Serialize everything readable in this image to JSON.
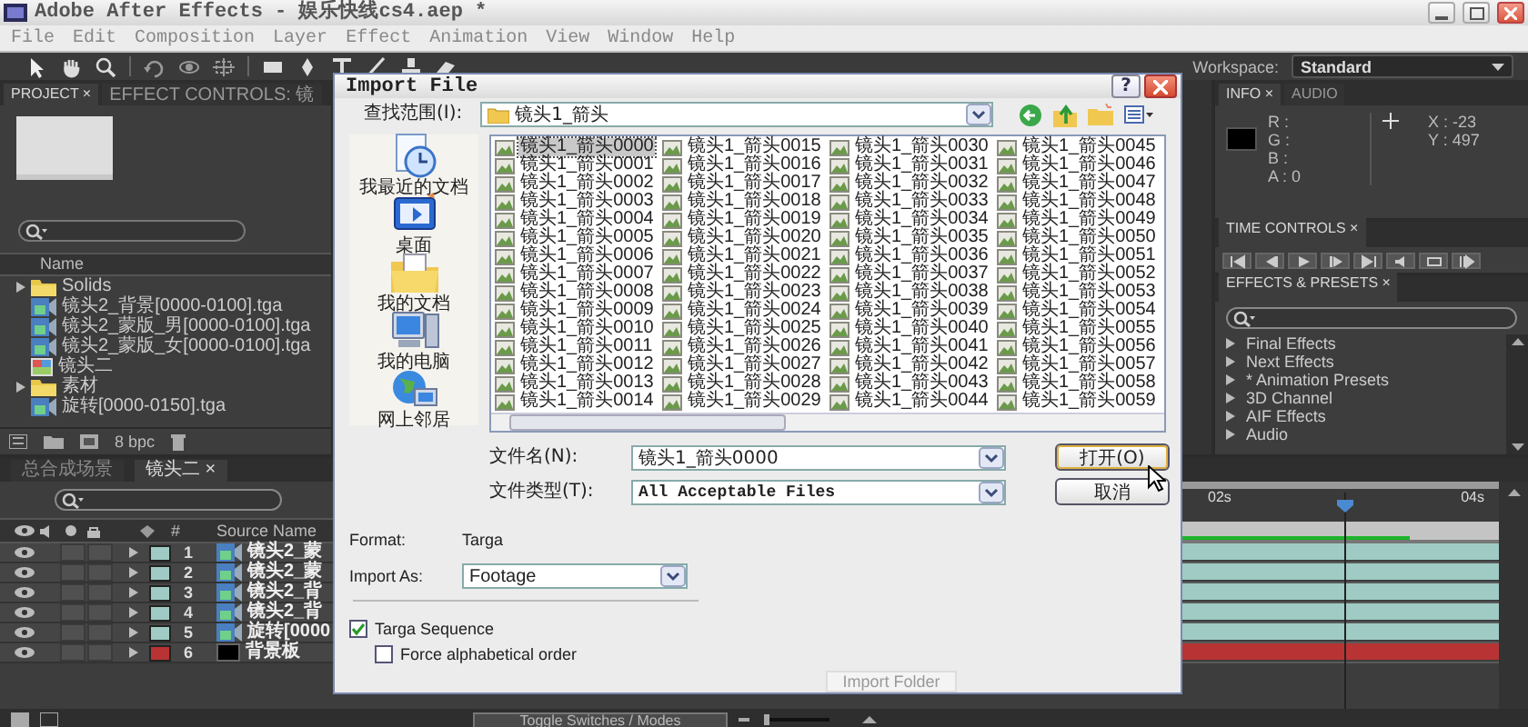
{
  "window": {
    "title": "Adobe After Effects - 娱乐快线cs4.aep *"
  },
  "menu": [
    "File",
    "Edit",
    "Composition",
    "Layer",
    "Effect",
    "Animation",
    "View",
    "Window",
    "Help"
  ],
  "workspace": {
    "label": "Workspace:",
    "value": "Standard"
  },
  "project_panel": {
    "tabs": [
      {
        "label": "PROJECT ×",
        "selected": true
      },
      {
        "label": "EFFECT CONTROLS: 镜",
        "selected": false
      }
    ],
    "column": "Name",
    "items": [
      {
        "kind": "folder",
        "name": "Solids"
      },
      {
        "kind": "sequence",
        "name": "镜头2_背景[0000-0100].tga"
      },
      {
        "kind": "sequence",
        "name": "镜头2_蒙版_男[0000-0100].tga"
      },
      {
        "kind": "sequence",
        "name": "镜头2_蒙版_女[0000-0100].tga"
      },
      {
        "kind": "comp",
        "name": "镜头二"
      },
      {
        "kind": "folder",
        "name": "素材"
      },
      {
        "kind": "sequence",
        "name": "旋转[0000-0150].tga"
      }
    ],
    "bit_depth": "8 bpc"
  },
  "info_panel": {
    "tabs": [
      {
        "label": "INFO ×",
        "selected": true
      },
      {
        "label": "AUDIO",
        "selected": false
      }
    ],
    "channels": [
      "R :",
      "G :",
      "B :",
      "A : 0"
    ],
    "coordinates": [
      "X : -23",
      "Y : 497"
    ]
  },
  "time_controls": {
    "tab": "TIME CONTROLS ×"
  },
  "effects_panel": {
    "tab": "EFFECTS & PRESETS ×",
    "items": [
      "Final Effects",
      "Next Effects",
      "* Animation Presets",
      "3D Channel",
      "AIF Effects",
      "Audio"
    ]
  },
  "timeline": {
    "tabs": [
      {
        "label": "总合成场景",
        "selected": false
      },
      {
        "label": "镜头二 ×",
        "selected": true
      }
    ],
    "columns": {
      "number": "#",
      "source": "Source Name"
    },
    "layers": [
      {
        "number": "1",
        "kind": "footage",
        "name": "镜头2_蒙",
        "color": "#9fcbc4"
      },
      {
        "number": "2",
        "kind": "footage",
        "name": "镜头2_蒙",
        "color": "#9fcbc4"
      },
      {
        "number": "3",
        "kind": "footage",
        "name": "镜头2_背",
        "color": "#9fcbc4"
      },
      {
        "number": "4",
        "kind": "footage",
        "name": "镜头2_背",
        "color": "#9fcbc4"
      },
      {
        "number": "5",
        "kind": "footage",
        "name": "旋转[0000",
        "color": "#9fcbc4"
      },
      {
        "number": "6",
        "kind": "solid",
        "name": "背景板",
        "color": "#b83434"
      }
    ],
    "ruler": [
      "02s",
      "04s"
    ],
    "toggle_button": "Toggle Switches / Modes"
  },
  "dialog": {
    "title": "Import File",
    "help_button": "?",
    "look_in": {
      "label": "查找范围(I):",
      "value": "镜头1_箭头"
    },
    "places": [
      {
        "kind": "recent",
        "label": "我最近的文档"
      },
      {
        "kind": "desktop",
        "label": "桌面"
      },
      {
        "kind": "documents",
        "label": "我的文档"
      },
      {
        "kind": "computer",
        "label": "我的电脑"
      },
      {
        "kind": "network",
        "label": "网上邻居"
      }
    ],
    "files": [
      {
        "name": "镜头1_箭头0000",
        "selected": true
      },
      {
        "name": "镜头1_箭头0001",
        "selected": false
      },
      {
        "name": "镜头1_箭头0002",
        "selected": false
      },
      {
        "name": "镜头1_箭头0003",
        "selected": false
      },
      {
        "name": "镜头1_箭头0004",
        "selected": false
      },
      {
        "name": "镜头1_箭头0005",
        "selected": false
      },
      {
        "name": "镜头1_箭头0006",
        "selected": false
      },
      {
        "name": "镜头1_箭头0007",
        "selected": false
      },
      {
        "name": "镜头1_箭头0008",
        "selected": false
      },
      {
        "name": "镜头1_箭头0009",
        "selected": false
      },
      {
        "name": "镜头1_箭头0010",
        "selected": false
      },
      {
        "name": "镜头1_箭头0011",
        "selected": false
      },
      {
        "name": "镜头1_箭头0012",
        "selected": false
      },
      {
        "name": "镜头1_箭头0013",
        "selected": false
      },
      {
        "name": "镜头1_箭头0014",
        "selected": false
      },
      {
        "name": "镜头1_箭头0015",
        "selected": false
      },
      {
        "name": "镜头1_箭头0016",
        "selected": false
      },
      {
        "name": "镜头1_箭头0017",
        "selected": false
      },
      {
        "name": "镜头1_箭头0018",
        "selected": false
      },
      {
        "name": "镜头1_箭头0019",
        "selected": false
      },
      {
        "name": "镜头1_箭头0020",
        "selected": false
      },
      {
        "name": "镜头1_箭头0021",
        "selected": false
      },
      {
        "name": "镜头1_箭头0022",
        "selected": false
      },
      {
        "name": "镜头1_箭头0023",
        "selected": false
      },
      {
        "name": "镜头1_箭头0024",
        "selected": false
      },
      {
        "name": "镜头1_箭头0025",
        "selected": false
      },
      {
        "name": "镜头1_箭头0026",
        "selected": false
      },
      {
        "name": "镜头1_箭头0027",
        "selected": false
      },
      {
        "name": "镜头1_箭头0028",
        "selected": false
      },
      {
        "name": "镜头1_箭头0029",
        "selected": false
      },
      {
        "name": "镜头1_箭头0030",
        "selected": false
      },
      {
        "name": "镜头1_箭头0031",
        "selected": false
      },
      {
        "name": "镜头1_箭头0032",
        "selected": false
      },
      {
        "name": "镜头1_箭头0033",
        "selected": false
      },
      {
        "name": "镜头1_箭头0034",
        "selected": false
      },
      {
        "name": "镜头1_箭头0035",
        "selected": false
      },
      {
        "name": "镜头1_箭头0036",
        "selected": false
      },
      {
        "name": "镜头1_箭头0037",
        "selected": false
      },
      {
        "name": "镜头1_箭头0038",
        "selected": false
      },
      {
        "name": "镜头1_箭头0039",
        "selected": false
      },
      {
        "name": "镜头1_箭头0040",
        "selected": false
      },
      {
        "name": "镜头1_箭头0041",
        "selected": false
      },
      {
        "name": "镜头1_箭头0042",
        "selected": false
      },
      {
        "name": "镜头1_箭头0043",
        "selected": false
      },
      {
        "name": "镜头1_箭头0044",
        "selected": false
      },
      {
        "name": "镜头1_箭头0045",
        "selected": false
      },
      {
        "name": "镜头1_箭头0046",
        "selected": false
      },
      {
        "name": "镜头1_箭头0047",
        "selected": false
      },
      {
        "name": "镜头1_箭头0048",
        "selected": false
      },
      {
        "name": "镜头1_箭头0049",
        "selected": false
      },
      {
        "name": "镜头1_箭头0050",
        "selected": false
      },
      {
        "name": "镜头1_箭头0051",
        "selected": false
      },
      {
        "name": "镜头1_箭头0052",
        "selected": false
      },
      {
        "name": "镜头1_箭头0053",
        "selected": false
      },
      {
        "name": "镜头1_箭头0054",
        "selected": false
      },
      {
        "name": "镜头1_箭头0055",
        "selected": false
      },
      {
        "name": "镜头1_箭头0056",
        "selected": false
      },
      {
        "name": "镜头1_箭头0057",
        "selected": false
      },
      {
        "name": "镜头1_箭头0058",
        "selected": false
      },
      {
        "name": "镜头1_箭头0059",
        "selected": false
      }
    ],
    "file_name": {
      "label": "文件名(N):",
      "value": "镜头1_箭头0000"
    },
    "file_type": {
      "label": "文件类型(T):",
      "value": "All Acceptable Files"
    },
    "buttons": [
      {
        "kind": "default",
        "label": "打开(O)"
      },
      {
        "kind": "normal",
        "label": "取消"
      }
    ],
    "format": {
      "label": "Format:",
      "value": "Targa"
    },
    "import_as": {
      "label": "Import As:",
      "value": "Footage"
    },
    "options": [
      {
        "label": "Targa Sequence",
        "checked": true,
        "children": [
          {
            "label": "Force alphabetical order",
            "checked": false
          }
        ]
      }
    ],
    "import_folder": {
      "label": "Import Folder",
      "disabled": true
    }
  }
}
